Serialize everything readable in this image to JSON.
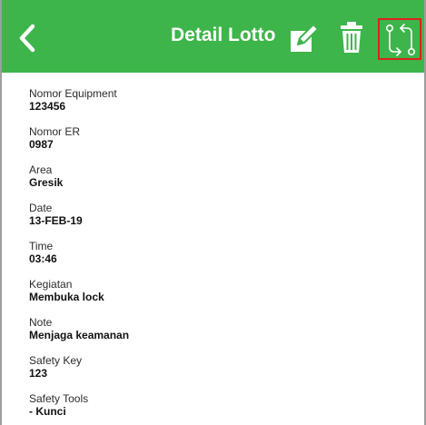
{
  "header": {
    "title": "Detail Lotto",
    "back_icon": "chevron-left-icon",
    "edit_icon": "edit-icon",
    "delete_icon": "trash-icon",
    "workflow_icon": "workflow-icon",
    "background_color": "#3db54a",
    "highlight_color": "#e0201e"
  },
  "fields": [
    {
      "label": "Nomor Equipment",
      "value": "123456"
    },
    {
      "label": "Nomor ER",
      "value": "0987"
    },
    {
      "label": "Area",
      "value": "Gresik"
    },
    {
      "label": "Date",
      "value": "13-FEB-19"
    },
    {
      "label": "Time",
      "value": "03:46"
    },
    {
      "label": "Kegiatan",
      "value": "Membuka lock"
    },
    {
      "label": "Note",
      "value": "Menjaga keamanan"
    },
    {
      "label": "Safety Key",
      "value": "123"
    },
    {
      "label": "Safety Tools",
      "value": "- Kunci"
    }
  ]
}
